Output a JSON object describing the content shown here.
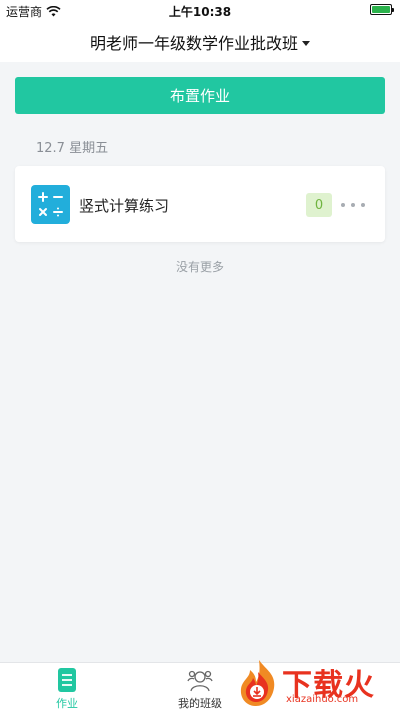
{
  "status_bar": {
    "carrier": "运营商",
    "time": "上午10:38",
    "wifi_icon": "wifi-icon",
    "battery_icon": "battery-icon",
    "battery_color": "#2bb24c"
  },
  "nav": {
    "title": "明老师一年级数学作业批改班",
    "dropdown_icon": "caret-down-icon"
  },
  "assign_button": {
    "label": "布置作业",
    "color": "#21c7a1"
  },
  "date_group": {
    "label": "12.7 星期五"
  },
  "homework_list": [
    {
      "title": "竖式计算练习",
      "icon": "math-operators-icon",
      "count": "0",
      "more_icon": "more-dots-icon"
    }
  ],
  "footer_note": "没有更多",
  "tab_bar": {
    "tabs": [
      {
        "label": "作业",
        "icon": "homework-list-icon",
        "active": true
      },
      {
        "label": "我的班级",
        "icon": "class-users-icon",
        "active": false
      }
    ]
  },
  "watermark": {
    "title": "下载火",
    "subtitle": "xiazaihuo.com"
  }
}
